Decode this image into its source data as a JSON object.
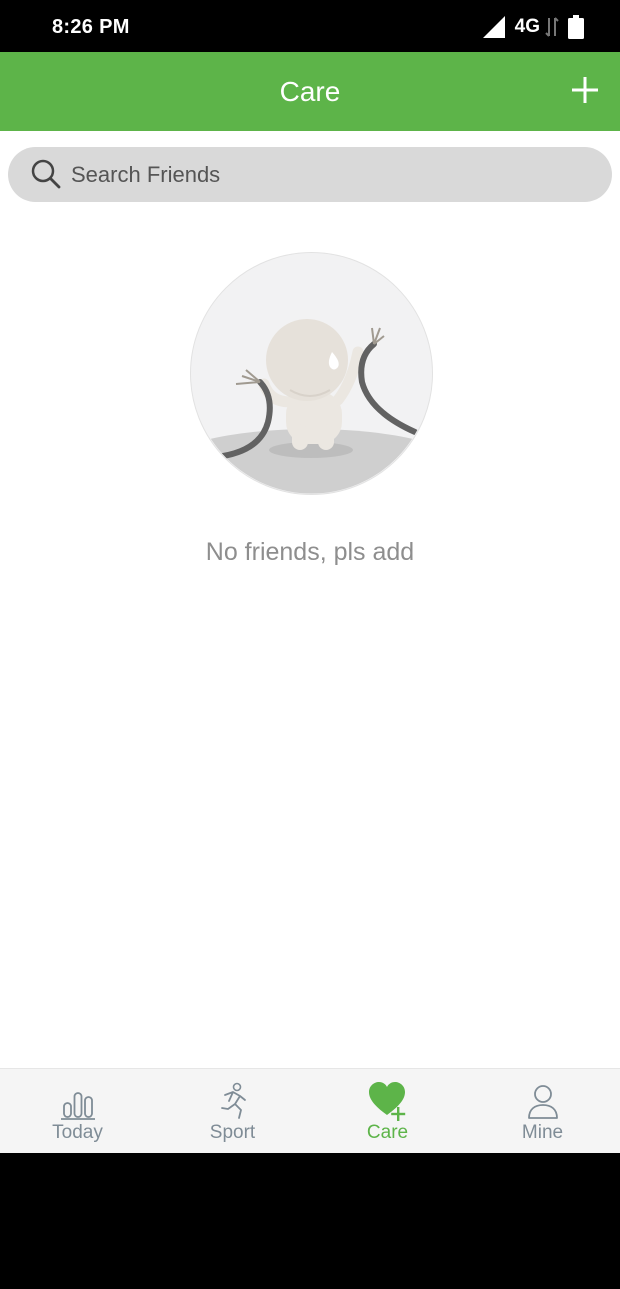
{
  "status_bar": {
    "time": "8:26 PM",
    "network": "4G",
    "icons": [
      "signal-icon",
      "data-transfer-icon",
      "battery-icon"
    ]
  },
  "header": {
    "title": "Care",
    "add_icon": "plus-icon"
  },
  "search": {
    "placeholder": "Search Friends",
    "value": "",
    "icon": "search-icon"
  },
  "empty_state": {
    "illustration": "disconnected-cable-character",
    "message": "No friends, pls add"
  },
  "bottom_nav": {
    "active": "Care",
    "items": [
      {
        "label": "Today",
        "icon": "bar-chart-icon"
      },
      {
        "label": "Sport",
        "icon": "running-person-icon"
      },
      {
        "label": "Care",
        "icon": "heart-plus-icon"
      },
      {
        "label": "Mine",
        "icon": "person-icon"
      }
    ]
  },
  "colors": {
    "primary": "#5db449",
    "inactive_nav": "#7f8c96",
    "search_bg": "#d9d9d9",
    "empty_text": "#8e8e8e"
  }
}
